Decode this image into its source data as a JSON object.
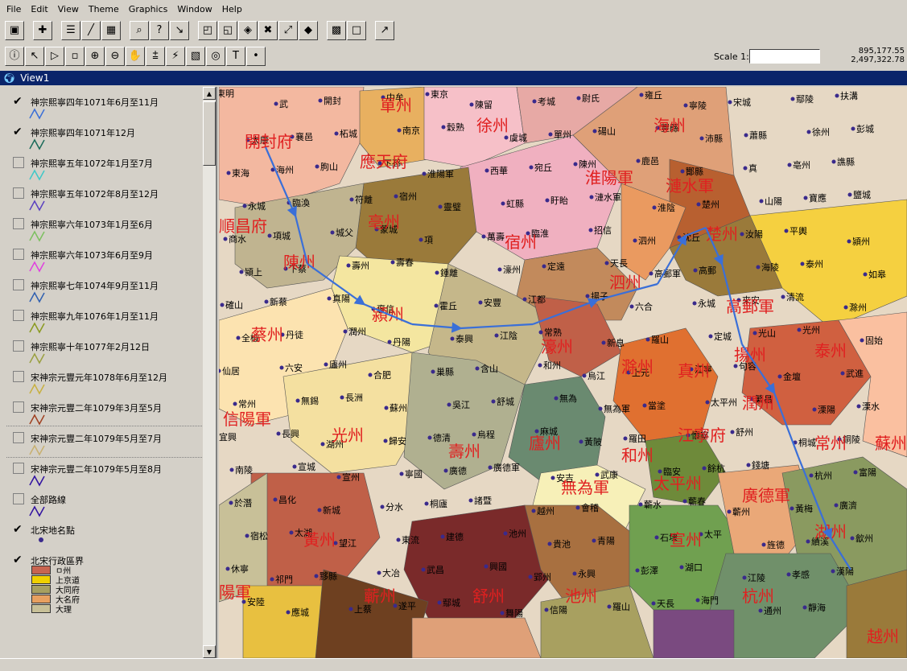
{
  "menu": [
    "File",
    "Edit",
    "View",
    "Theme",
    "Graphics",
    "Window",
    "Help"
  ],
  "toolbar1_icons": [
    "save-icon",
    "add-theme-icon",
    "theme-props-icon",
    "edit-legend-icon",
    "table-icon",
    "find-icon",
    "query-icon",
    "locate-icon",
    "zoom-full-icon",
    "zoom-active-icon",
    "zoom-selected-icon",
    "zoom-in-fixed-icon",
    "zoom-out-fixed-icon",
    "zoom-previous-icon",
    "select-all-icon",
    "clear-select-icon",
    "help-icon"
  ],
  "toolbar2_icons": [
    "identify-icon",
    "pointer-icon",
    "vertex-edit-icon",
    "select-feature-icon",
    "zoom-in-icon",
    "zoom-out-icon",
    "pan-icon",
    "measure-icon",
    "hotlink-icon",
    "area-of-interest-icon",
    "label-icon",
    "text-icon",
    "draw-point-icon"
  ],
  "scale": {
    "label": "Scale 1:",
    "value": ""
  },
  "coords": {
    "x": "895,177.55",
    "y": "2,497,322.78"
  },
  "view_title": "View1",
  "toc": [
    {
      "label": "神宗熙寧四年1071年6月至11月",
      "checked": true,
      "color": "#3a6fd8"
    },
    {
      "label": "神宗熙寧四年1071年12月",
      "checked": true,
      "color": "#1b6b5a"
    },
    {
      "label": "神宗熙寧五年1072年1月至7月",
      "checked": false,
      "color": "#3fc8c8"
    },
    {
      "label": "神宗熙寧五年1072年8月至12月",
      "checked": false,
      "color": "#5a40c0"
    },
    {
      "label": "神宗熙寧六年1073年1月至6月",
      "checked": false,
      "color": "#7cc060"
    },
    {
      "label": "神宗熙寧六年1073年6月至9月",
      "checked": false,
      "color": "#e040e0"
    },
    {
      "label": "神宗熙寧七年1074年9月至11月",
      "checked": false,
      "color": "#3060b0"
    },
    {
      "label": "神宗熙寧九年1076年1月至11月",
      "checked": false,
      "color": "#8a9a20"
    },
    {
      "label": "神宗熙寧十年1077年2月12日",
      "checked": false,
      "color": "#9aa040"
    },
    {
      "label": "宋神宗元豐元年1078年6月至12月",
      "checked": false,
      "color": "#c8b040"
    },
    {
      "label": "宋神宗元豐二年1079年3月至5月",
      "checked": false,
      "color": "#a04020"
    },
    {
      "label": "宋神宗元豐二年1079年5月至7月",
      "checked": false,
      "color": "#c8b070"
    },
    {
      "label": "宋神宗元豐二年1079年5月至8月",
      "checked": false,
      "color": "#3010a0"
    },
    {
      "label": "全部路線",
      "checked": false,
      "color": "#3010a0"
    },
    {
      "label": "北宋地名點",
      "checked": true,
      "color": "#3a2a8c"
    },
    {
      "label": "北宋行政區界",
      "checked": true,
      "color": ""
    }
  ],
  "legend": [
    {
      "label": "ㅁ州",
      "color": "#c86450"
    },
    {
      "label": "上京道",
      "color": "#f0d000"
    },
    {
      "label": "大同府",
      "color": "#a8a060"
    },
    {
      "label": "大名府",
      "color": "#e8a060"
    },
    {
      "label": "大理",
      "color": "#c8c098"
    }
  ],
  "map": {
    "big_labels": [
      {
        "t": "開封府"
      },
      {
        "t": "應天府"
      },
      {
        "t": "單州"
      },
      {
        "t": "徐州"
      },
      {
        "t": "海州"
      },
      {
        "t": "淮陽軍"
      },
      {
        "t": "漣水軍"
      },
      {
        "t": "亳州"
      },
      {
        "t": "宿州"
      },
      {
        "t": "楚州"
      },
      {
        "t": "陳州"
      },
      {
        "t": "潁州"
      },
      {
        "t": "泗州"
      },
      {
        "t": "高郵軍"
      },
      {
        "t": "蔡州"
      },
      {
        "t": "濠州"
      },
      {
        "t": "揚州"
      },
      {
        "t": "泰州"
      },
      {
        "t": "滁州"
      },
      {
        "t": "真州"
      },
      {
        "t": "信陽軍"
      },
      {
        "t": "光州"
      },
      {
        "t": "壽州"
      },
      {
        "t": "廬州"
      },
      {
        "t": "和州"
      },
      {
        "t": "江寧府"
      },
      {
        "t": "潤州"
      },
      {
        "t": "常州"
      },
      {
        "t": "蘇州"
      },
      {
        "t": "無為軍"
      },
      {
        "t": "太平州"
      },
      {
        "t": "黃州"
      },
      {
        "t": "廣德軍"
      },
      {
        "t": "宣州"
      },
      {
        "t": "湖州"
      },
      {
        "t": "蘄州"
      },
      {
        "t": "舒州"
      },
      {
        "t": "池州"
      },
      {
        "t": "杭州"
      },
      {
        "t": "越州"
      },
      {
        "t": "陽軍"
      },
      {
        "t": "順昌府"
      }
    ],
    "small_labels": [
      "東明",
      "武",
      "開封",
      "中牟",
      "東京",
      "陳留",
      "考城",
      "尉氏",
      "雍丘",
      "寧陵",
      "宋城",
      "鄢陵",
      "扶溝",
      "太康",
      "襄邑",
      "柘城",
      "南京",
      "穀熟",
      "虞城",
      "單州",
      "碭山",
      "豐縣",
      "沛縣",
      "蕭縣",
      "徐州",
      "彭城",
      "東海",
      "海州",
      "朐山",
      "下邳",
      "淮陽軍",
      "西華",
      "宛丘",
      "陳州",
      "鹿邑",
      "酇縣",
      "真",
      "亳州",
      "譙縣",
      "永城",
      "臨渙",
      "符離",
      "宿州",
      "靈璧",
      "虹縣",
      "盱眙",
      "漣水軍",
      "淮陰",
      "楚州",
      "山陽",
      "寶應",
      "鹽城",
      "商水",
      "項城",
      "城父",
      "蒙城",
      "項",
      "萬壽",
      "臨淮",
      "招信",
      "泗州",
      "沈丘",
      "汝陽",
      "平輿",
      "潁州",
      "潁上",
      "下蔡",
      "壽州",
      "壽春",
      "鍾離",
      "濠州",
      "定遠",
      "天長",
      "高郵軍",
      "高郵",
      "海陵",
      "泰州",
      "如皋",
      "確山",
      "新蔡",
      "真陽",
      "褒信",
      "霍丘",
      "安豐",
      "江都",
      "揚子",
      "六合",
      "永城",
      "來安",
      "清流",
      "滁州",
      "全椒",
      "丹徒",
      "潤州",
      "丹陽",
      "泰興",
      "江陰",
      "常熟",
      "新息",
      "羅山",
      "定城",
      "光山",
      "光州",
      "固始",
      "仙居",
      "六安",
      "廬州",
      "合肥",
      "巢縣",
      "含山",
      "和州",
      "烏江",
      "上元",
      "江寧",
      "句容",
      "金壇",
      "武進",
      "常州",
      "無錫",
      "長洲",
      "蘇州",
      "吳江",
      "舒城",
      "無為",
      "無為軍",
      "當塗",
      "太平州",
      "繁昌",
      "溧陽",
      "溧水",
      "宜興",
      "長興",
      "湖州",
      "歸安",
      "德清",
      "烏程",
      "麻城",
      "黃陂",
      "羅田",
      "懷寧",
      "舒州",
      "桐城",
      "銅陵",
      "南陵",
      "宣城",
      "宣州",
      "寧國",
      "廣德",
      "廣德軍",
      "安吉",
      "武康",
      "臨安",
      "餘杭",
      "錢塘",
      "杭州",
      "富陽",
      "於潛",
      "昌化",
      "新城",
      "分水",
      "桐廬",
      "諸暨",
      "越州",
      "會稽",
      "蘄水",
      "蘄春",
      "蘄州",
      "黃梅",
      "廣濟",
      "宿松",
      "太湖",
      "望江",
      "東流",
      "建德",
      "池州",
      "貴池",
      "青陽",
      "石埭",
      "太平",
      "旌德",
      "績溪",
      "歙州",
      "休寧",
      "祁門",
      "黟縣",
      "大冶",
      "武昌",
      "興國",
      "郢州",
      "永興",
      "彭澤",
      "湖口",
      "江陵",
      "孝感",
      "漢陽",
      "安陸",
      "應城",
      "上蔡",
      "遂平",
      "鄢城",
      "舞陽",
      "信陽",
      "羅山",
      "天長",
      "海門",
      "通州",
      "靜海"
    ],
    "route_color": "#3a6fd8"
  }
}
